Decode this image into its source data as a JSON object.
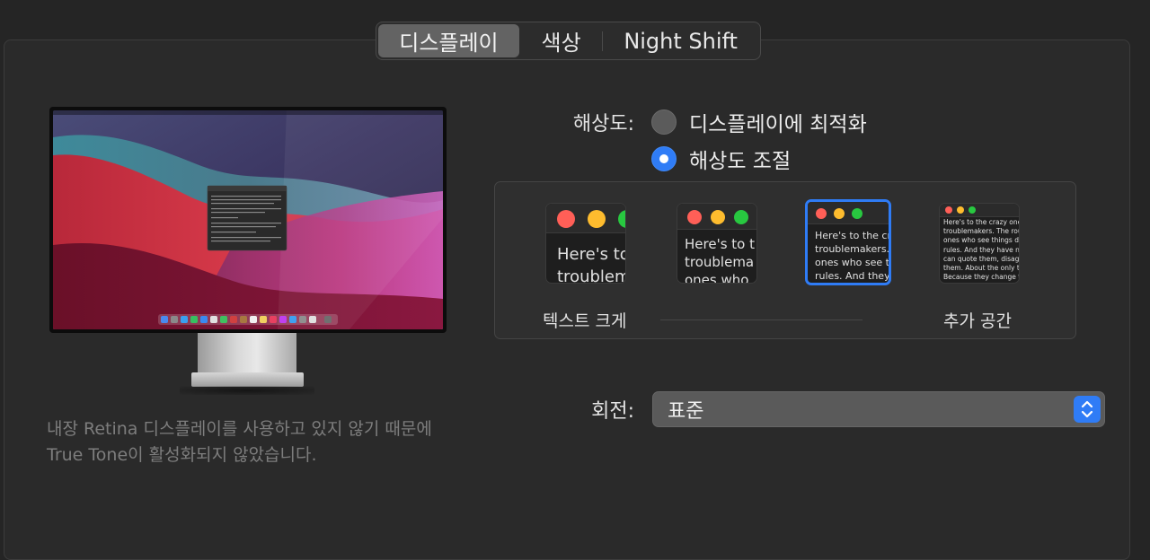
{
  "tabs": [
    {
      "label": "디스플레이",
      "active": true
    },
    {
      "label": "색상",
      "active": false
    },
    {
      "label": "Night Shift",
      "active": false
    }
  ],
  "resolution": {
    "label": "해상도:",
    "options": [
      {
        "label": "디스플레이에 최적화",
        "selected": false
      },
      {
        "label": "해상도 조절",
        "selected": true
      }
    ]
  },
  "scaling": {
    "previews": [
      {
        "text": "Here's to\ntroublem"
      },
      {
        "text": "Here's to t\ntroublema\nones who"
      },
      {
        "text": "Here's to the cr\ntroublemakers.\nones who see t\nrules. And they",
        "selected": true
      },
      {
        "text": "Here's to the crazy ones\ntroublemakers. The rou\nones who see things dif\nrules. And they have no\ncan quote them, disagre\nthem. About the only th\nBecause they change th"
      }
    ],
    "left_caption": "텍스트 크게",
    "right_caption": "추가 공간"
  },
  "rotation": {
    "label": "회전:",
    "value": "표준"
  },
  "truetone_note": "내장 Retina 디스플레이를 사용하고 있지 않기 때문에 True Tone이 활성화되지 않았습니다.",
  "colors": {
    "accent": "#2f7cf6",
    "traffic_red": "#ff5f57",
    "traffic_yellow": "#febc2e",
    "traffic_green": "#28c840"
  }
}
